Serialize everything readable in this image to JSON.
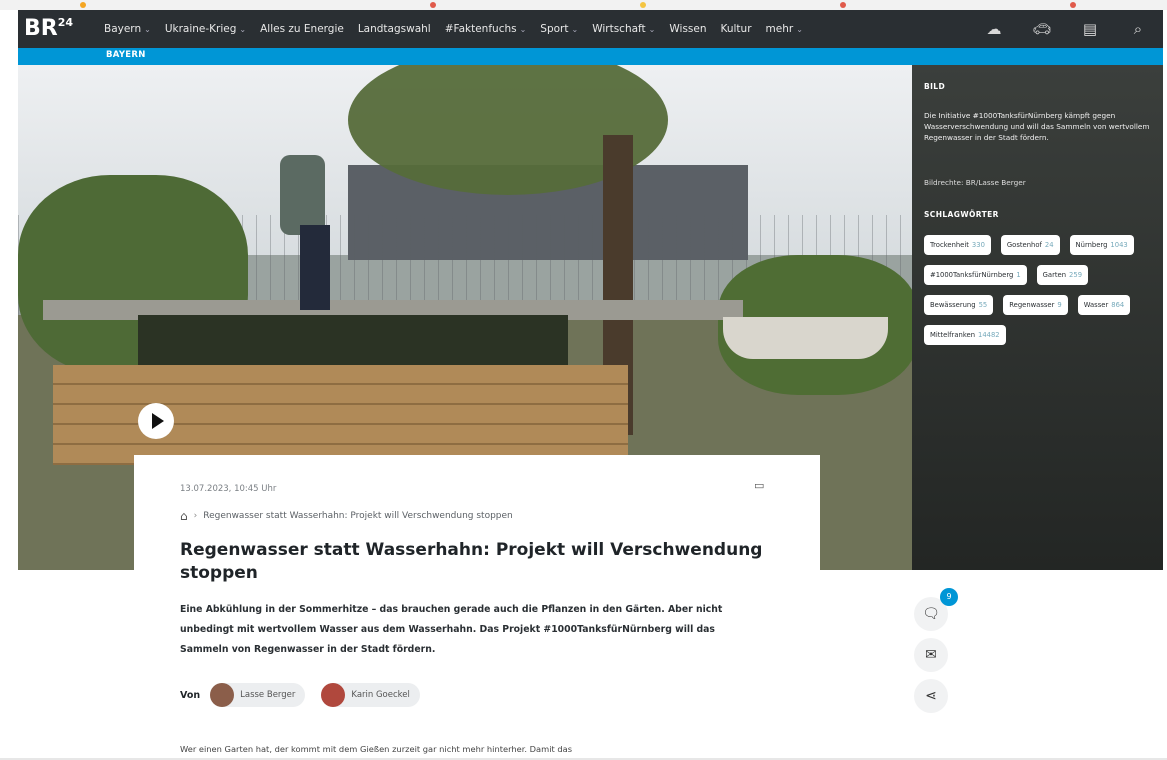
{
  "nav": {
    "logo": "BR",
    "logo_sup": "24",
    "items": [
      {
        "label": "Bayern",
        "has_menu": true
      },
      {
        "label": "Ukraine-Krieg",
        "has_menu": true
      },
      {
        "label": "Alles zu Energie",
        "has_menu": false
      },
      {
        "label": "Landtagswahl",
        "has_menu": false
      },
      {
        "label": "#Faktenfuchs",
        "has_menu": true
      },
      {
        "label": "Sport",
        "has_menu": true
      },
      {
        "label": "Wirtschaft",
        "has_menu": true
      },
      {
        "label": "Wissen",
        "has_menu": false
      },
      {
        "label": "Kultur",
        "has_menu": false
      },
      {
        "label": "mehr",
        "has_menu": true
      }
    ],
    "icons": [
      "weather-icon",
      "traffic-car-icon",
      "news-icon",
      "search-icon"
    ]
  },
  "region": "BAYERN",
  "sidebar": {
    "image_label": "BILD",
    "caption": "Die Initiative #1000TanksfürNürnberg kämpft gegen Wasserverschwendung und will das Sammeln von wertvollem Regenwasser in der Stadt fördern.",
    "credit": "Bildrechte: BR/Lasse Berger",
    "tags_label": "SCHLAGWÖRTER",
    "tags": [
      {
        "name": "Trockenheit",
        "count": "330"
      },
      {
        "name": "Gostenhof",
        "count": "24"
      },
      {
        "name": "Nürnberg",
        "count": "1043"
      },
      {
        "name": "#1000TanksfürNürnberg",
        "count": "1"
      },
      {
        "name": "Garten",
        "count": "259"
      },
      {
        "name": "Bewässerung",
        "count": "55"
      },
      {
        "name": "Regenwasser",
        "count": "9"
      },
      {
        "name": "Wasser",
        "count": "864"
      },
      {
        "name": "Mittelfranken",
        "count": "14482"
      }
    ]
  },
  "article": {
    "date": "13.07.2023, 10:45 Uhr",
    "breadcrumb": "Regenwasser statt Wasserhahn: Projekt will Verschwendung stoppen",
    "title": "Regenwasser statt Wasserhahn: Projekt will Verschwendung stoppen",
    "teaser": "Eine Abkühlung in der Sommerhitze – das brauchen gerade auch die Pflanzen in den Gärten. Aber nicht unbedingt mit wertvollem Wasser aus dem Wasserhahn. Das Projekt #1000TanksfürNürnberg will das Sammeln von Regenwasser in der Stadt fördern.",
    "by_label": "Von",
    "authors": [
      "Lasse Berger",
      "Karin Goeckel"
    ],
    "body_start": "Wer einen Garten hat, der kommt mit dem Gießen zurzeit gar nicht mehr hinterher. Damit das"
  },
  "actions": {
    "comment_count": "9"
  }
}
